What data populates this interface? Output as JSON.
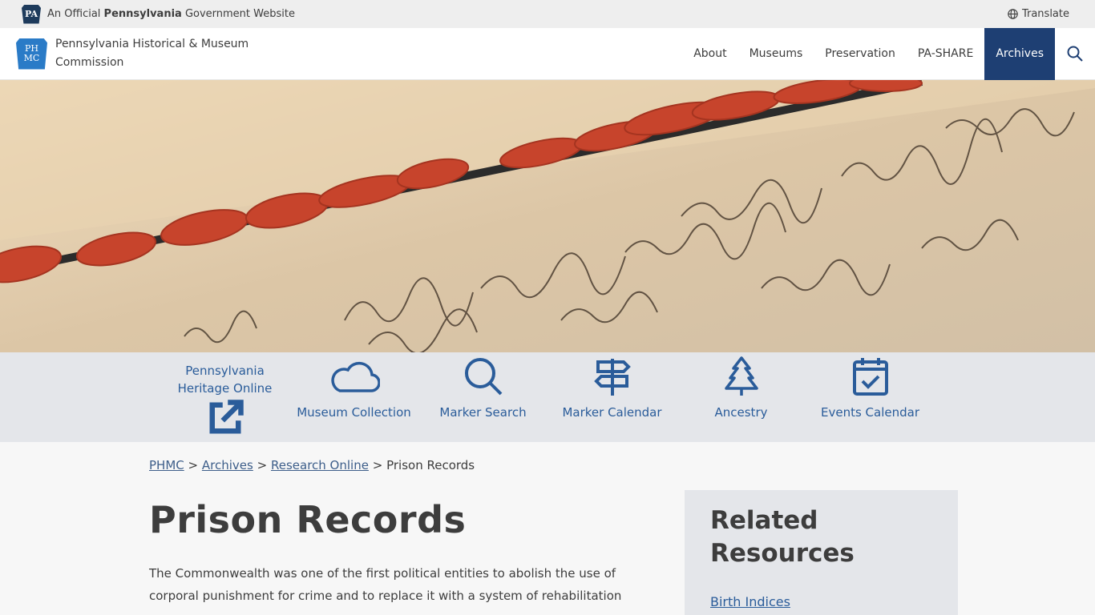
{
  "official_bar": {
    "pa_badge": "PA",
    "prefix": "An Official ",
    "state": "Pennsylvania",
    "suffix": " Government Website",
    "translate_label": "Translate"
  },
  "header": {
    "logo_text": "PHMC",
    "site_name": "Pennsylvania Historical & Museum Commission",
    "nav": [
      {
        "label": "About"
      },
      {
        "label": "Museums"
      },
      {
        "label": "Preservation"
      },
      {
        "label": "PA-SHARE"
      },
      {
        "label": "Archives"
      }
    ]
  },
  "quick_links": [
    {
      "label": "Pennsylvania Heritage Online",
      "icon": "book-icon",
      "external": true
    },
    {
      "label": "Museum Collection",
      "icon": "cloud-icon"
    },
    {
      "label": "Marker Search",
      "icon": "search-icon"
    },
    {
      "label": "Marker Calendar",
      "icon": "signpost-icon"
    },
    {
      "label": "Ancestry",
      "icon": "tree-icon"
    },
    {
      "label": "Events Calendar",
      "icon": "calendar-check-icon"
    }
  ],
  "breadcrumb": {
    "items": [
      "PHMC",
      "Archives",
      "Research Online"
    ],
    "separator": ">",
    "current": "Prison Records"
  },
  "page": {
    "title": "Prison Records",
    "intro": "The Commonwealth was one of the first political entities to abolish the use of corporal punishment for crime and to replace it with a system of rehabilitation"
  },
  "related": {
    "heading": "Related Resources",
    "links": [
      "Birth Indices"
    ]
  },
  "colors": {
    "nav_active": "#1e3f73",
    "link": "#2a5c9a",
    "quick_links_bg": "#e4e6ea",
    "wax_seal": "#c8412a"
  }
}
